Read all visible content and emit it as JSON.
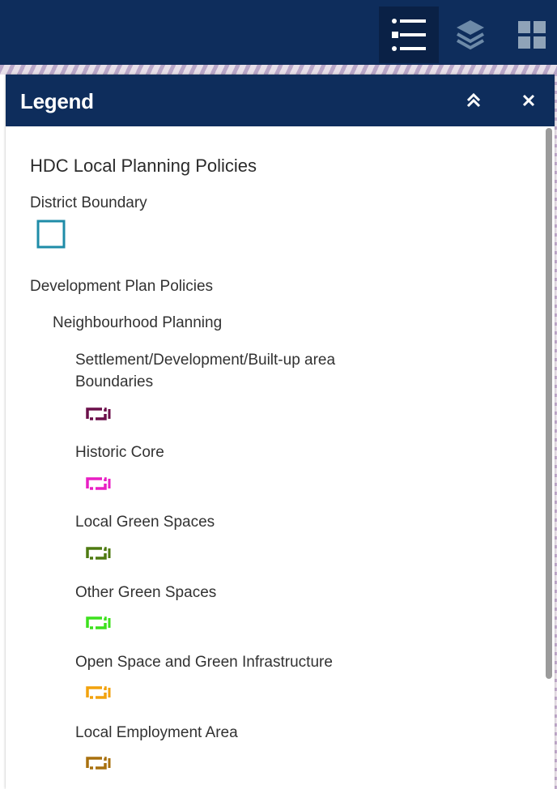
{
  "topbar": {
    "tools": [
      {
        "name": "legend",
        "icon": "legend-list-icon",
        "active": true
      },
      {
        "name": "layers",
        "icon": "layers-icon",
        "active": false
      },
      {
        "name": "basemap",
        "icon": "grid-icon",
        "active": false
      }
    ]
  },
  "panel": {
    "title": "Legend",
    "collapse_icon": "double-chevron-up-icon",
    "close_icon": "close-icon"
  },
  "legend": {
    "layer_title": "HDC Local Planning Policies",
    "district_boundary": {
      "label": "District Boundary",
      "color": "#1f8ca8"
    },
    "group_label": "Development Plan Policies",
    "subgroup_label": "Neighbourhood Planning",
    "items": [
      {
        "label_line1": "Settlement/Development/Built-up area",
        "label_line2": "Boundaries",
        "color": "#6b0f4a"
      },
      {
        "label": "Historic Core",
        "color": "#e91ec4"
      },
      {
        "label": "Local Green Spaces",
        "color": "#4e7a10"
      },
      {
        "label": "Other Green Spaces",
        "color": "#3de11d"
      },
      {
        "label": "Open Space and Green Infrastructure",
        "color": "#f2a20c"
      },
      {
        "label": "Local Employment Area",
        "color": "#a8700e"
      }
    ]
  },
  "colors": {
    "header_bg": "#0e2d5c",
    "header_text": "#ffffff"
  }
}
